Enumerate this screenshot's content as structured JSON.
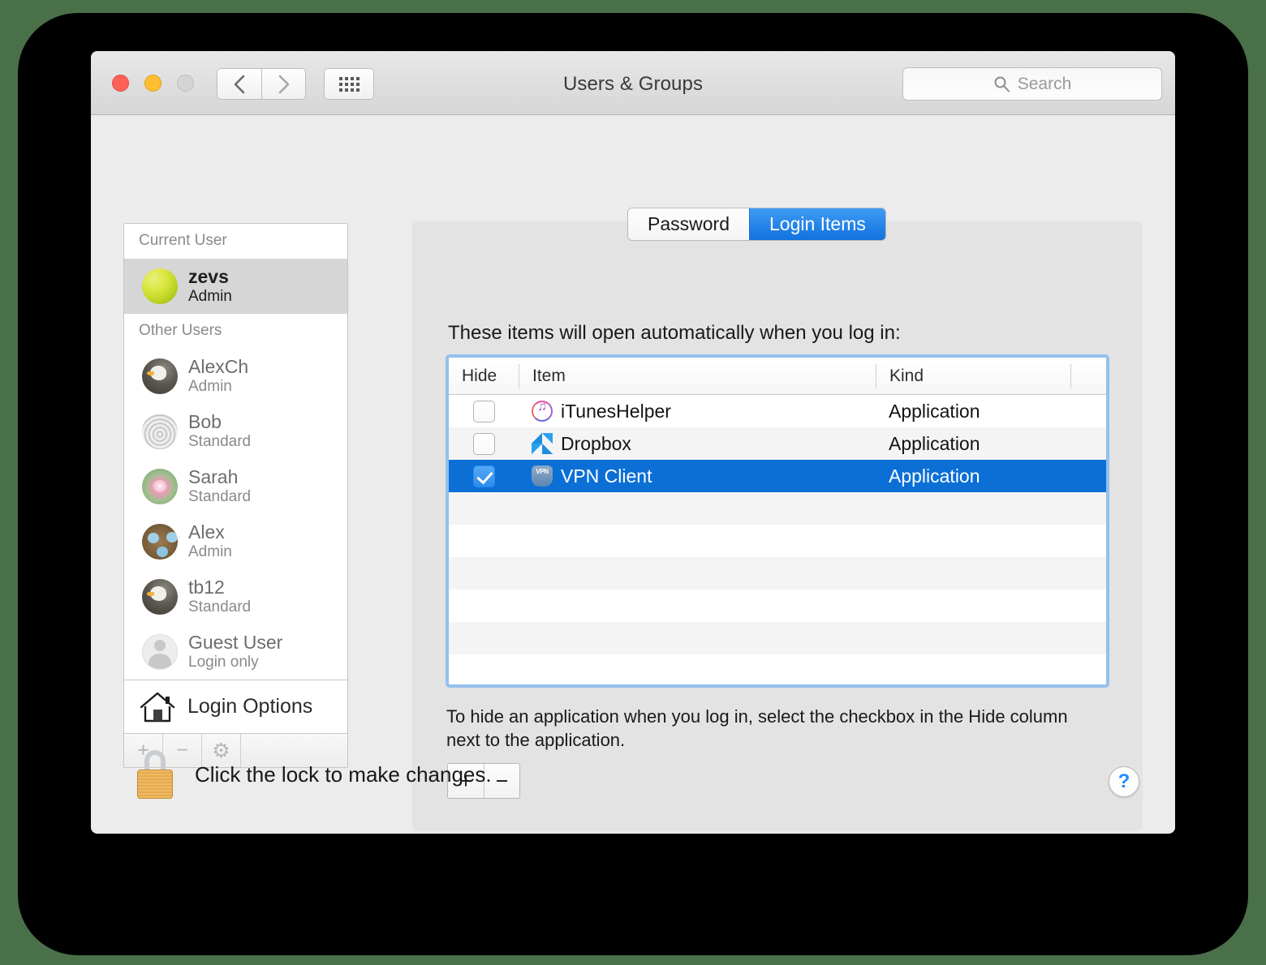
{
  "window": {
    "title": "Users & Groups",
    "traffic_lights": [
      "close",
      "minimize",
      "zoom"
    ],
    "nav": {
      "back": "‹",
      "forward": "›"
    },
    "search": {
      "placeholder": "Search",
      "value": ""
    }
  },
  "sidebar": {
    "current_user_header": "Current User",
    "other_users_header": "Other Users",
    "current_user": {
      "name": "zevs",
      "role": "Admin",
      "avatar": "tennis-ball",
      "selected": true
    },
    "other_users": [
      {
        "name": "AlexCh",
        "role": "Admin",
        "avatar": "eagle"
      },
      {
        "name": "Bob",
        "role": "Standard",
        "avatar": "fingerprint"
      },
      {
        "name": "Sarah",
        "role": "Standard",
        "avatar": "lotus-flower"
      },
      {
        "name": "Alex",
        "role": "Admin",
        "avatar": "bird-nest"
      },
      {
        "name": "tb12",
        "role": "Standard",
        "avatar": "eagle"
      },
      {
        "name": "Guest User",
        "role": "Login only",
        "avatar": "guest-silhouette"
      }
    ],
    "login_options_label": "Login Options",
    "toolbar": {
      "add": "+",
      "remove": "−",
      "settings": "⚙"
    }
  },
  "tabs": [
    {
      "label": "Password",
      "active": false
    },
    {
      "label": "Login Items",
      "active": true
    }
  ],
  "main": {
    "intro_text": "These items will open automatically when you log in:",
    "hint_text": "To hide an application when you log in, select the checkbox in the Hide column next to the application.",
    "table": {
      "columns": [
        "Hide",
        "Item",
        "Kind"
      ],
      "rows": [
        {
          "hide_checked": false,
          "item": "iTunesHelper",
          "kind": "Application",
          "icon": "itunes-icon",
          "selected": false
        },
        {
          "hide_checked": false,
          "item": "Dropbox",
          "kind": "Application",
          "icon": "dropbox-icon",
          "selected": false
        },
        {
          "hide_checked": true,
          "item": "VPN Client",
          "kind": "Application",
          "icon": "vpn-shield-icon",
          "selected": true
        }
      ],
      "empty_row_count": 6
    },
    "add_button": "+",
    "remove_button": "−"
  },
  "footer": {
    "lock_text": "Click the lock to make changes.",
    "help_label": "?"
  },
  "colors": {
    "accent_blue": "#0b6fd6",
    "tab_active": "#1272e0",
    "focus_ring": "#94c0ec",
    "desktop_green": "#4a7049",
    "window_bg": "#ececec"
  }
}
